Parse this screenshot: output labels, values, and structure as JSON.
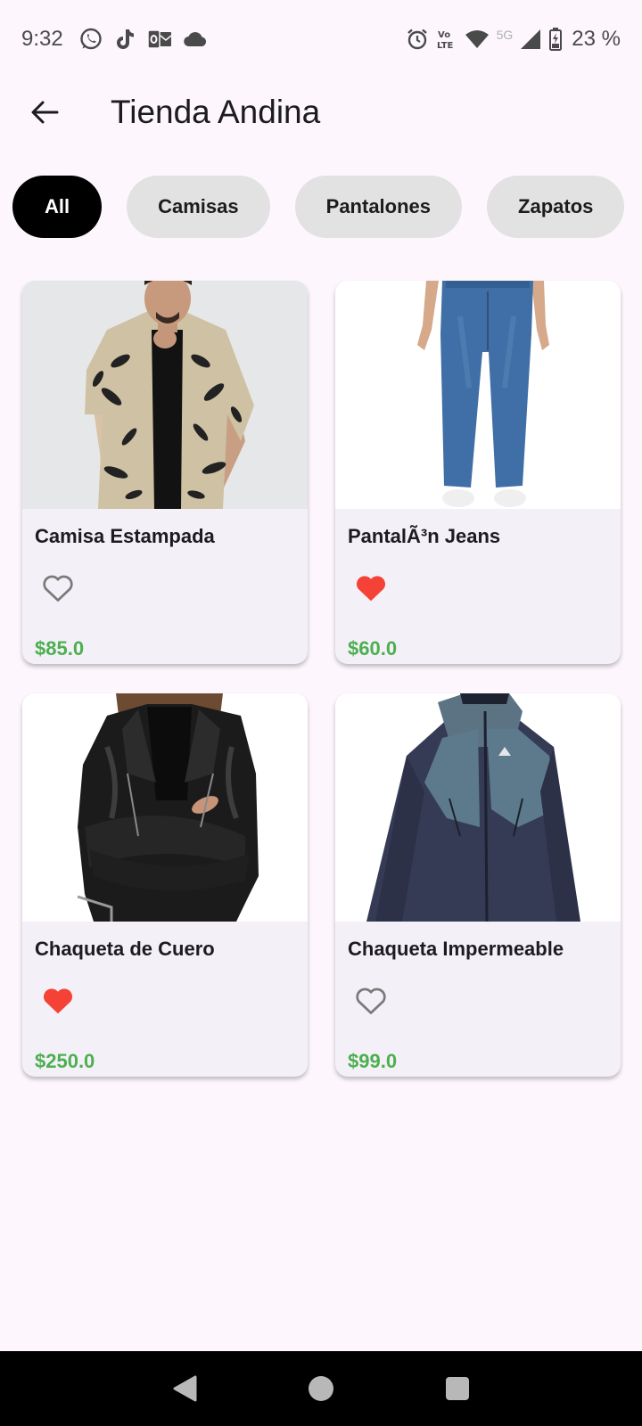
{
  "status_bar": {
    "time": "9:32",
    "battery_text": "23 %",
    "network_label": "5G",
    "left_icons": [
      "whatsapp-icon",
      "tiktok-icon",
      "outlook-icon",
      "cloud-icon"
    ],
    "right_icons": [
      "alarm-icon",
      "volte-icon",
      "wifi-icon",
      "signal-icon",
      "battery-icon"
    ]
  },
  "app_bar": {
    "title": "Tienda Andina",
    "back_icon": "arrow-back-icon"
  },
  "filters": [
    {
      "label": "All",
      "active": true
    },
    {
      "label": "Camisas",
      "active": false
    },
    {
      "label": "Pantalones",
      "active": false
    },
    {
      "label": "Zapatos",
      "active": false
    }
  ],
  "products": [
    {
      "name": "Camisa Estampada",
      "price": "$85.0",
      "favorite": false,
      "image": "printed-shirt-photo"
    },
    {
      "name": "PantalÃ³n Jeans",
      "price": "$60.0",
      "favorite": true,
      "image": "jeans-photo"
    },
    {
      "name": "Chaqueta de Cuero",
      "price": "$250.0",
      "favorite": true,
      "image": "leather-jacket-photo"
    },
    {
      "name": "Chaqueta Impermeable",
      "price": "$99.0",
      "favorite": false,
      "image": "rain-jacket-photo"
    }
  ],
  "colors": {
    "background": "#fdf7fd",
    "chip_active": "#000000",
    "chip_inactive": "#e2e2e2",
    "price": "#4caf50",
    "favorite": "#f44336",
    "card": "#f4f0f7"
  },
  "nav_bar": {
    "icons": [
      "back-triangle-icon",
      "home-circle-icon",
      "recents-square-icon"
    ]
  }
}
